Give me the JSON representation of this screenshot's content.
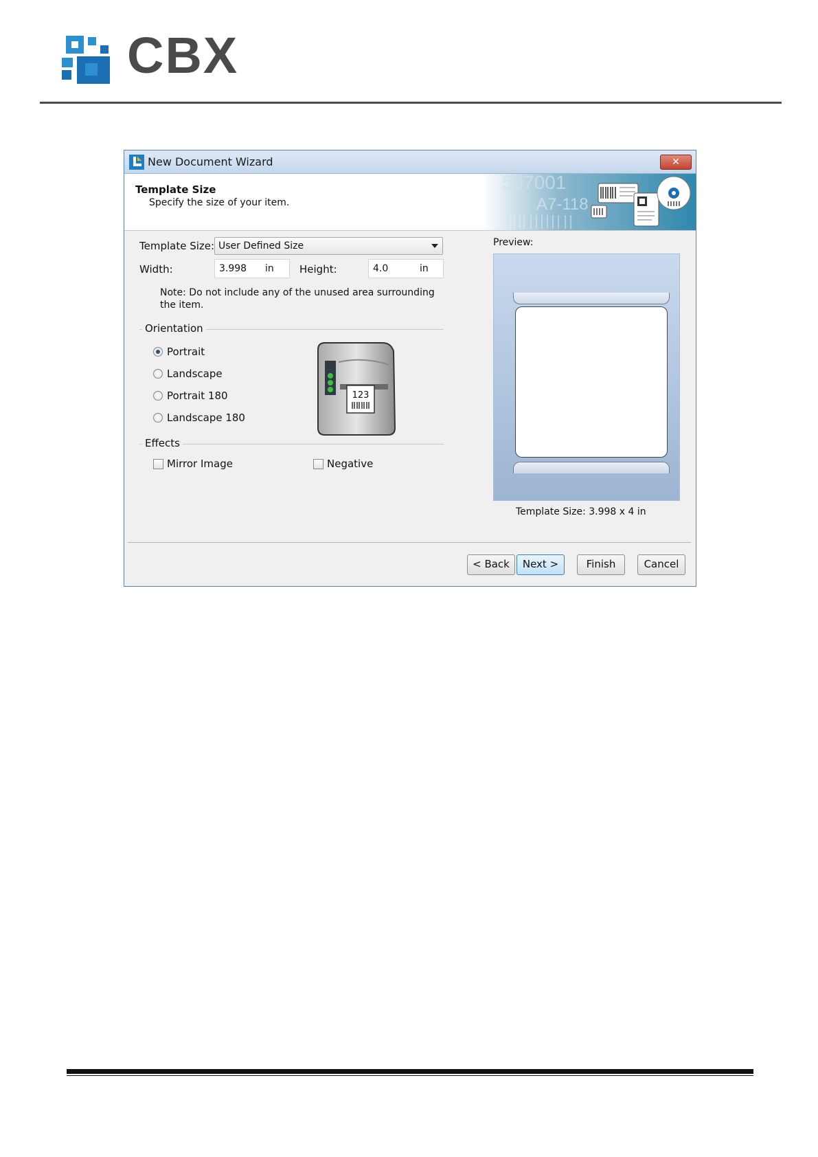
{
  "page": {
    "logo_text": "CBX"
  },
  "dialog": {
    "title": "New Document Wizard",
    "close_glyph": "✕",
    "banner": {
      "title": "Template Size",
      "subtitle": "Specify the size of your item.",
      "art_number": "597001",
      "art_code": "A7-118"
    },
    "template_size_label": "Template Size:",
    "template_size_value": "User Defined Size",
    "width_label": "Width:",
    "width_value": "3.998",
    "width_unit": "in",
    "height_label": "Height:",
    "height_value": "4.0",
    "height_unit": "in",
    "note_line1": "Note: Do not include any of the unused area surrounding",
    "note_line2": "the item.",
    "orientation": {
      "title": "Orientation",
      "options": [
        "Portrait",
        "Landscape",
        "Portrait 180",
        "Landscape 180"
      ],
      "selected": "Portrait"
    },
    "printer_label_text": "123",
    "effects": {
      "title": "Effects",
      "mirror_label": "Mirror Image",
      "mirror_checked": false,
      "negative_label": "Negative",
      "negative_checked": false
    },
    "preview": {
      "label": "Preview:",
      "caption": "Template Size:  3.998 x 4 in"
    },
    "buttons": {
      "back": "< Back",
      "next": "Next >",
      "finish": "Finish",
      "cancel": "Cancel"
    }
  }
}
